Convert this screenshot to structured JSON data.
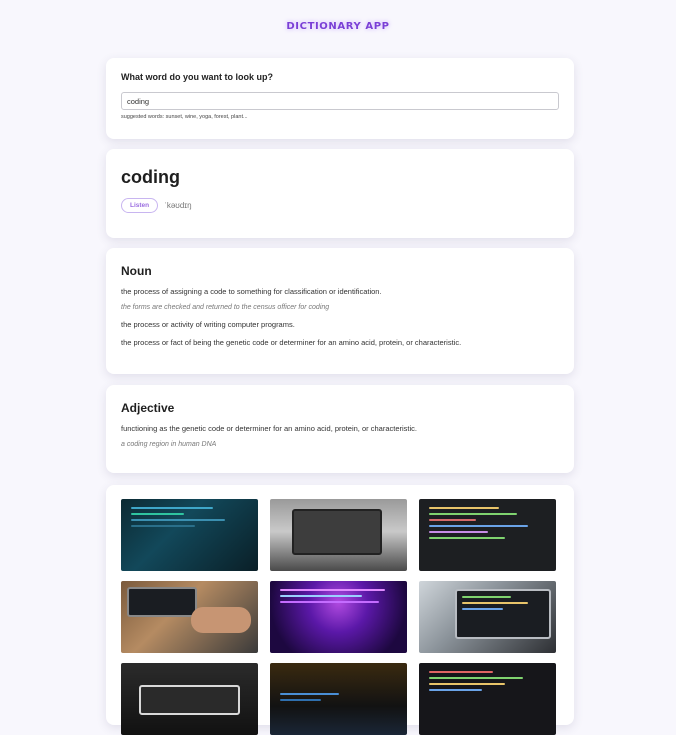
{
  "app": {
    "title": "Dictionary App"
  },
  "search": {
    "question": "What word do you want to look up?",
    "value": "coding",
    "suggestions": "suggested words: sunset, wine, yoga, forest, plant..."
  },
  "word": {
    "text": "coding",
    "listen_label": "Listen",
    "phonetic": "ˈkəʊdɪŋ"
  },
  "meanings": [
    {
      "part_of_speech": "Noun",
      "definitions": [
        {
          "definition": "the process of assigning a code to something for classification or identification.",
          "example": "the forms are checked and returned to the census officer for coding"
        },
        {
          "definition": "the process or activity of writing computer programs."
        },
        {
          "definition": "the process or fact of being the genetic code or determiner for an amino acid, protein, or characteristic."
        }
      ]
    },
    {
      "part_of_speech": "Adjective",
      "definitions": [
        {
          "definition": "functioning as the genetic code or determiner for an amino acid, protein, or characteristic.",
          "example": "a coding region in human DNA"
        }
      ]
    }
  ],
  "photos": [
    {
      "subject": "monitor with code and glasses"
    },
    {
      "subject": "laptop on desk black and white"
    },
    {
      "subject": "code on dark screen"
    },
    {
      "subject": "hands typing on laptop"
    },
    {
      "subject": "purple code light"
    },
    {
      "subject": "laptop with code"
    },
    {
      "subject": "keyboard in dark"
    },
    {
      "subject": "dark screen with code"
    },
    {
      "subject": "colorful code lines"
    }
  ],
  "colors": {
    "accent": "#7a3fd6",
    "listen_border": "#c8b5f0",
    "background": "#f8f7fd"
  }
}
